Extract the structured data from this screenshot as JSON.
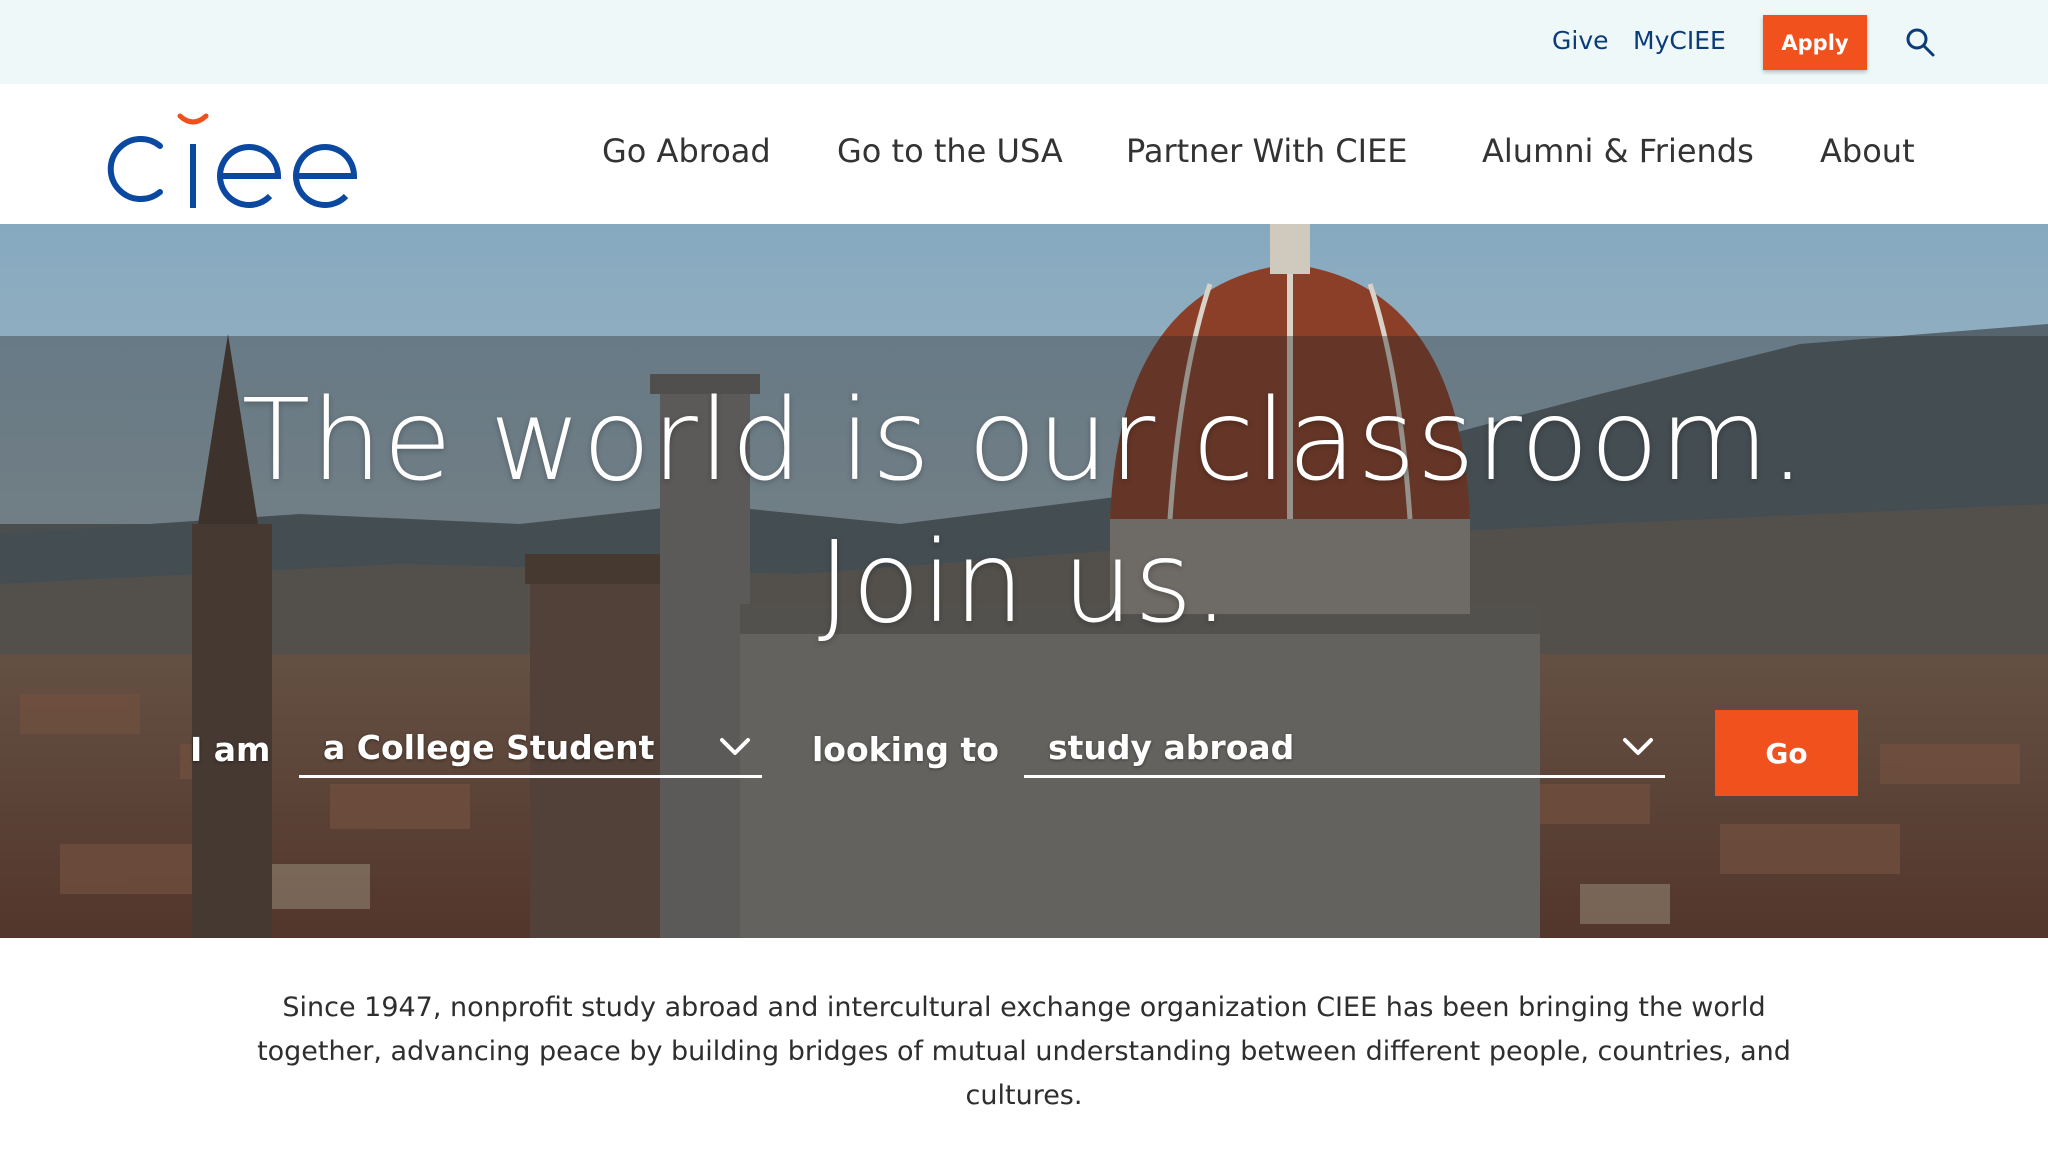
{
  "utility": {
    "give": "Give",
    "myciee": "MyCIEE",
    "apply": "Apply",
    "search_icon": "search-icon"
  },
  "brand": {
    "logo_text": "ciee",
    "logo_color": "#0b48a0",
    "accent_color": "#f0511d"
  },
  "nav": {
    "items": [
      {
        "label": "Go Abroad"
      },
      {
        "label": "Go to the USA"
      },
      {
        "label": "Partner With CIEE"
      },
      {
        "label": "Alumni & Friends"
      },
      {
        "label": "About"
      }
    ]
  },
  "hero": {
    "title_line1": "The world is our classroom.",
    "title_line2": "Join us.",
    "label_iam": "I am",
    "role_selected": "a College Student",
    "label_looking": "looking to",
    "goal_selected": "study abroad",
    "go": "Go"
  },
  "intro": {
    "text": "Since 1947, nonprofit study abroad and intercultural exchange organization CIEE has been bringing the world together, advancing peace by building bridges of mutual understanding between different people, countries, and cultures."
  }
}
